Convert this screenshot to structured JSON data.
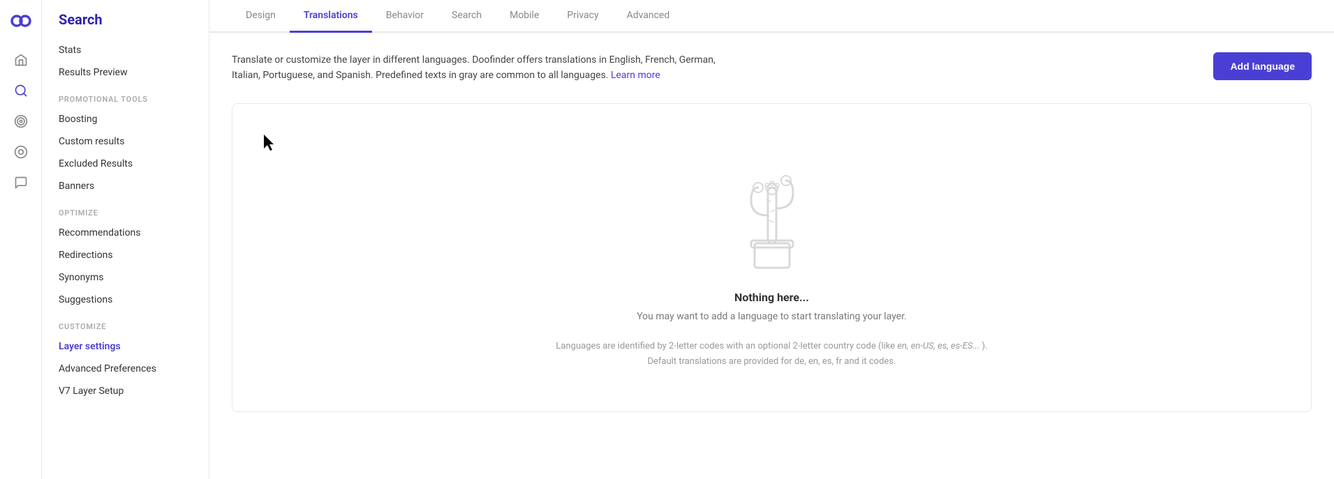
{
  "app": {
    "logo_text": "∞",
    "title": "Search"
  },
  "icon_nav": [
    {
      "name": "home-icon",
      "glyph": "⌂",
      "active": false
    },
    {
      "name": "search-nav-icon",
      "glyph": "◎",
      "active": true
    },
    {
      "name": "target-icon",
      "glyph": "◉",
      "active": false
    },
    {
      "name": "chat-icon",
      "glyph": "☐",
      "active": false
    }
  ],
  "sidebar": {
    "title": "Search",
    "items": [
      {
        "label": "Stats",
        "name": "sidebar-item-stats",
        "active": false
      },
      {
        "label": "Results Preview",
        "name": "sidebar-item-results-preview",
        "active": false
      }
    ],
    "sections": [
      {
        "label": "PROMOTIONAL TOOLS",
        "items": [
          {
            "label": "Boosting",
            "name": "sidebar-item-boosting",
            "active": false
          },
          {
            "label": "Custom results",
            "name": "sidebar-item-custom-results",
            "active": false
          },
          {
            "label": "Excluded Results",
            "name": "sidebar-item-excluded-results",
            "active": false
          },
          {
            "label": "Banners",
            "name": "sidebar-item-banners",
            "active": false
          }
        ]
      },
      {
        "label": "OPTIMIZE",
        "items": [
          {
            "label": "Recommendations",
            "name": "sidebar-item-recommendations",
            "active": false
          },
          {
            "label": "Redirections",
            "name": "sidebar-item-redirections",
            "active": false
          },
          {
            "label": "Synonyms",
            "name": "sidebar-item-synonyms",
            "active": false
          },
          {
            "label": "Suggestions",
            "name": "sidebar-item-suggestions",
            "active": false
          }
        ]
      },
      {
        "label": "CUSTOMIZE",
        "items": [
          {
            "label": "Layer settings",
            "name": "sidebar-item-layer-settings",
            "active": true
          },
          {
            "label": "Advanced Preferences",
            "name": "sidebar-item-advanced-preferences",
            "active": false
          },
          {
            "label": "V7 Layer Setup",
            "name": "sidebar-item-v7-layer-setup",
            "active": false
          }
        ]
      }
    ]
  },
  "tabs": [
    {
      "label": "Design",
      "name": "tab-design",
      "active": false
    },
    {
      "label": "Translations",
      "name": "tab-translations",
      "active": true
    },
    {
      "label": "Behavior",
      "name": "tab-behavior",
      "active": false
    },
    {
      "label": "Search",
      "name": "tab-search",
      "active": false
    },
    {
      "label": "Mobile",
      "name": "tab-mobile",
      "active": false
    },
    {
      "label": "Privacy",
      "name": "tab-privacy",
      "active": false
    },
    {
      "label": "Advanced",
      "name": "tab-advanced",
      "active": false
    }
  ],
  "content": {
    "description": "Translate or customize the layer in different languages. Doofinder offers translations in English, French, German, Italian, Portuguese, and Spanish. Predefined texts in gray are common to all languages.",
    "learn_more_text": "Learn more",
    "add_language_button": "Add language",
    "empty_state": {
      "title": "Nothing here...",
      "subtitle": "You may want to add a language to start translating your layer.",
      "note_line1": "Languages are identified by 2-letter codes with an optional 2-letter country code (like",
      "note_codes": "en, en-US, es, es-ES...",
      "note_line2": ").",
      "note_line3": "Default translations are provided for de, en, es, fr and it codes."
    }
  }
}
